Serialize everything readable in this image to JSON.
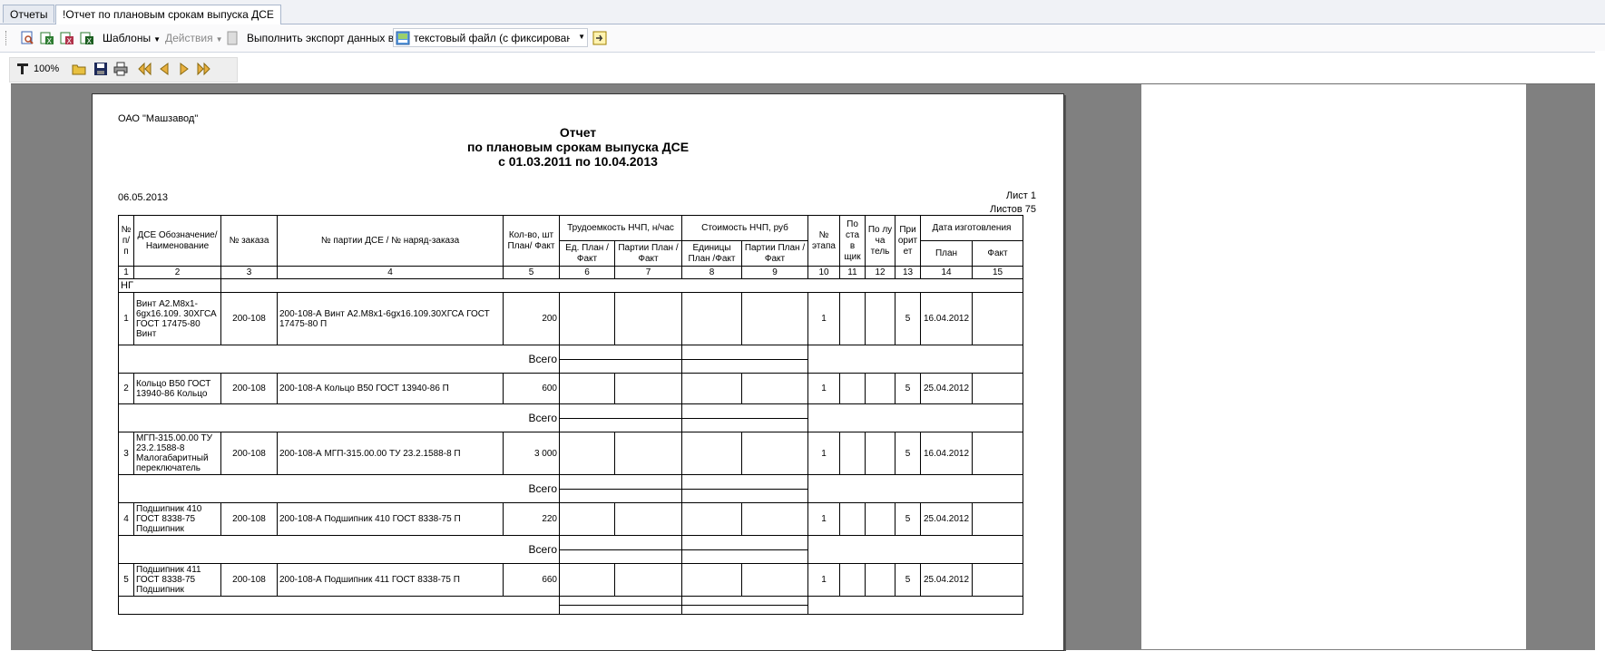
{
  "tabs": [
    {
      "label": "Отчеты"
    },
    {
      "label": "!Отчет по плановым срокам выпуска ДСЕ"
    }
  ],
  "toolbar": {
    "templates_label": "Шаблоны",
    "actions_label": "Действия",
    "export_label": "Выполнить экспорт данных в:",
    "export_format": "текстовый файл (с фиксированным",
    "zoom_label": "100%"
  },
  "report": {
    "org": "ОАО \"Машзавод\"",
    "title_line1": "Отчет",
    "title_line2": "по плановым срокам выпуска ДСЕ",
    "title_line3": "с 01.03.2011 по 10.04.2013",
    "date": "06.05.2013",
    "sheet": "Лист 1",
    "sheets_total": "Листов 75",
    "headers": {
      "num": "№ п/п",
      "dse": "ДСЕ Обозначение/ Наименование",
      "order": "№ заказа",
      "batch": "№ партии ДСЕ / № наряд-заказа",
      "qty": "Кол-во, шт План/ Факт",
      "labor": "Трудоемкость НЧП, н/час",
      "labor_unit": "Ед. План /Факт",
      "labor_batch": "Партии План /Факт",
      "cost": "Стоимость НЧП, руб",
      "cost_unit": "Единицы План /Факт",
      "cost_batch": "Партии План /Факт",
      "stage": "№ этапа",
      "supplier": "По ста в щик",
      "receiver": "По лу ча тель",
      "priority": "При орит ет",
      "mfg_date": "Дата изготовления",
      "plan": "План",
      "fact": "Факт"
    },
    "col_numbers": [
      "1",
      "2",
      "3",
      "4",
      "5",
      "6",
      "7",
      "8",
      "9",
      "10",
      "11",
      "12",
      "13",
      "14",
      "15"
    ],
    "group": "НГ",
    "total_label": "Всего",
    "rows": [
      {
        "n": "1",
        "dse": "Винт А2.М8х1-6gх16.109. 30ХГСА ГОСТ 17475-80 Винт",
        "order": "200-108",
        "batch": "200-108-А Винт А2.М8х1-6gх16.109.30ХГСА ГОСТ 17475-80 П",
        "qty": "200",
        "stage": "1",
        "priority": "5",
        "plan_date": "16.04.2012"
      },
      {
        "n": "2",
        "dse": "Кольцо В50 ГОСТ 13940-86 Кольцо",
        "order": "200-108",
        "batch": "200-108-А Кольцо В50 ГОСТ 13940-86 П",
        "qty": "600",
        "stage": "1",
        "priority": "5",
        "plan_date": "25.04.2012"
      },
      {
        "n": "3",
        "dse": "МГП-315.00.00 ТУ 23.2.1588-8 Малогабаритный переключатель",
        "order": "200-108",
        "batch": "200-108-А МГП-315.00.00 ТУ 23.2.1588-8 П",
        "qty": "3 000",
        "stage": "1",
        "priority": "5",
        "plan_date": "16.04.2012"
      },
      {
        "n": "4",
        "dse": "Подшипник 410 ГОСТ 8338-75 Подшипник",
        "order": "200-108",
        "batch": "200-108-А Подшипник 410 ГОСТ 8338-75 П",
        "qty": "220",
        "stage": "1",
        "priority": "5",
        "plan_date": "25.04.2012"
      },
      {
        "n": "5",
        "dse": "Подшипник 411 ГОСТ 8338-75 Подшипник",
        "order": "200-108",
        "batch": "200-108-А Подшипник 411 ГОСТ 8338-75 П",
        "qty": "660",
        "stage": "1",
        "priority": "5",
        "plan_date": "25.04.2012"
      }
    ]
  }
}
